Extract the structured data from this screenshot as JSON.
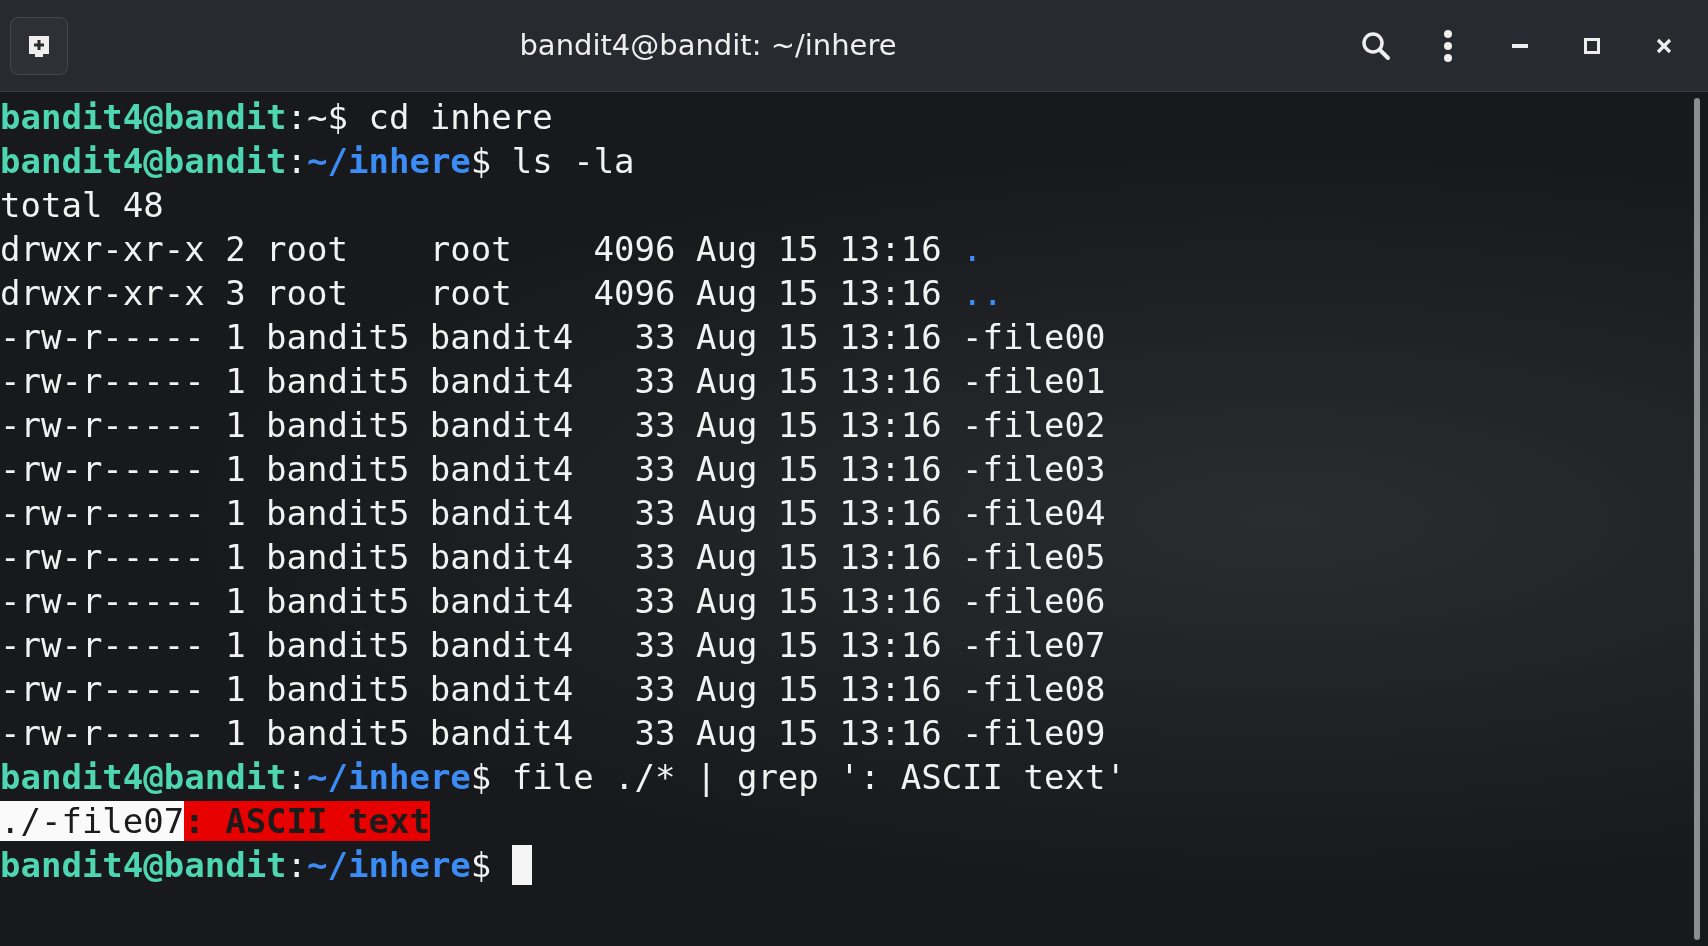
{
  "window": {
    "title": "bandit4@bandit: ~/inhere"
  },
  "terminal": {
    "lines": [
      {
        "cursor": false,
        "segments": [
          {
            "kind": "user",
            "text": "bandit4@bandit"
          },
          {
            "kind": "plain",
            "text": ":~$ cd inhere"
          }
        ]
      },
      {
        "cursor": false,
        "segments": [
          {
            "kind": "user",
            "text": "bandit4@bandit"
          },
          {
            "kind": "plain",
            "text": ":"
          },
          {
            "kind": "path",
            "text": "~/inhere"
          },
          {
            "kind": "plain",
            "text": "$ ls -la"
          }
        ]
      },
      {
        "cursor": false,
        "segments": [
          {
            "kind": "plain",
            "text": "total 48"
          }
        ]
      },
      {
        "cursor": false,
        "segments": [
          {
            "kind": "plain",
            "text": "drwxr-xr-x 2 root    root    4096 Aug 15 13:16 "
          },
          {
            "kind": "dir",
            "text": "."
          }
        ]
      },
      {
        "cursor": false,
        "segments": [
          {
            "kind": "plain",
            "text": "drwxr-xr-x 3 root    root    4096 Aug 15 13:16 "
          },
          {
            "kind": "dir",
            "text": ".."
          }
        ]
      },
      {
        "cursor": false,
        "segments": [
          {
            "kind": "plain",
            "text": "-rw-r----- 1 bandit5 bandit4   33 Aug 15 13:16 -file00"
          }
        ]
      },
      {
        "cursor": false,
        "segments": [
          {
            "kind": "plain",
            "text": "-rw-r----- 1 bandit5 bandit4   33 Aug 15 13:16 -file01"
          }
        ]
      },
      {
        "cursor": false,
        "segments": [
          {
            "kind": "plain",
            "text": "-rw-r----- 1 bandit5 bandit4   33 Aug 15 13:16 -file02"
          }
        ]
      },
      {
        "cursor": false,
        "segments": [
          {
            "kind": "plain",
            "text": "-rw-r----- 1 bandit5 bandit4   33 Aug 15 13:16 -file03"
          }
        ]
      },
      {
        "cursor": false,
        "segments": [
          {
            "kind": "plain",
            "text": "-rw-r----- 1 bandit5 bandit4   33 Aug 15 13:16 -file04"
          }
        ]
      },
      {
        "cursor": false,
        "segments": [
          {
            "kind": "plain",
            "text": "-rw-r----- 1 bandit5 bandit4   33 Aug 15 13:16 -file05"
          }
        ]
      },
      {
        "cursor": false,
        "segments": [
          {
            "kind": "plain",
            "text": "-rw-r----- 1 bandit5 bandit4   33 Aug 15 13:16 -file06"
          }
        ]
      },
      {
        "cursor": false,
        "segments": [
          {
            "kind": "plain",
            "text": "-rw-r----- 1 bandit5 bandit4   33 Aug 15 13:16 -file07"
          }
        ]
      },
      {
        "cursor": false,
        "segments": [
          {
            "kind": "plain",
            "text": "-rw-r----- 1 bandit5 bandit4   33 Aug 15 13:16 -file08"
          }
        ]
      },
      {
        "cursor": false,
        "segments": [
          {
            "kind": "plain",
            "text": "-rw-r----- 1 bandit5 bandit4   33 Aug 15 13:16 -file09"
          }
        ]
      },
      {
        "cursor": false,
        "segments": [
          {
            "kind": "user",
            "text": "bandit4@bandit"
          },
          {
            "kind": "plain",
            "text": ":"
          },
          {
            "kind": "path",
            "text": "~/inhere"
          },
          {
            "kind": "plain",
            "text": "$ file ./* | grep ': ASCII text'"
          }
        ]
      },
      {
        "cursor": false,
        "segments": [
          {
            "kind": "inverse",
            "text": "./-file07"
          },
          {
            "kind": "match",
            "text": ": ASCII text"
          }
        ]
      },
      {
        "cursor": true,
        "segments": [
          {
            "kind": "user",
            "text": "bandit4@bandit"
          },
          {
            "kind": "plain",
            "text": ":"
          },
          {
            "kind": "path",
            "text": "~/inhere"
          },
          {
            "kind": "plain",
            "text": "$ "
          }
        ]
      }
    ]
  }
}
